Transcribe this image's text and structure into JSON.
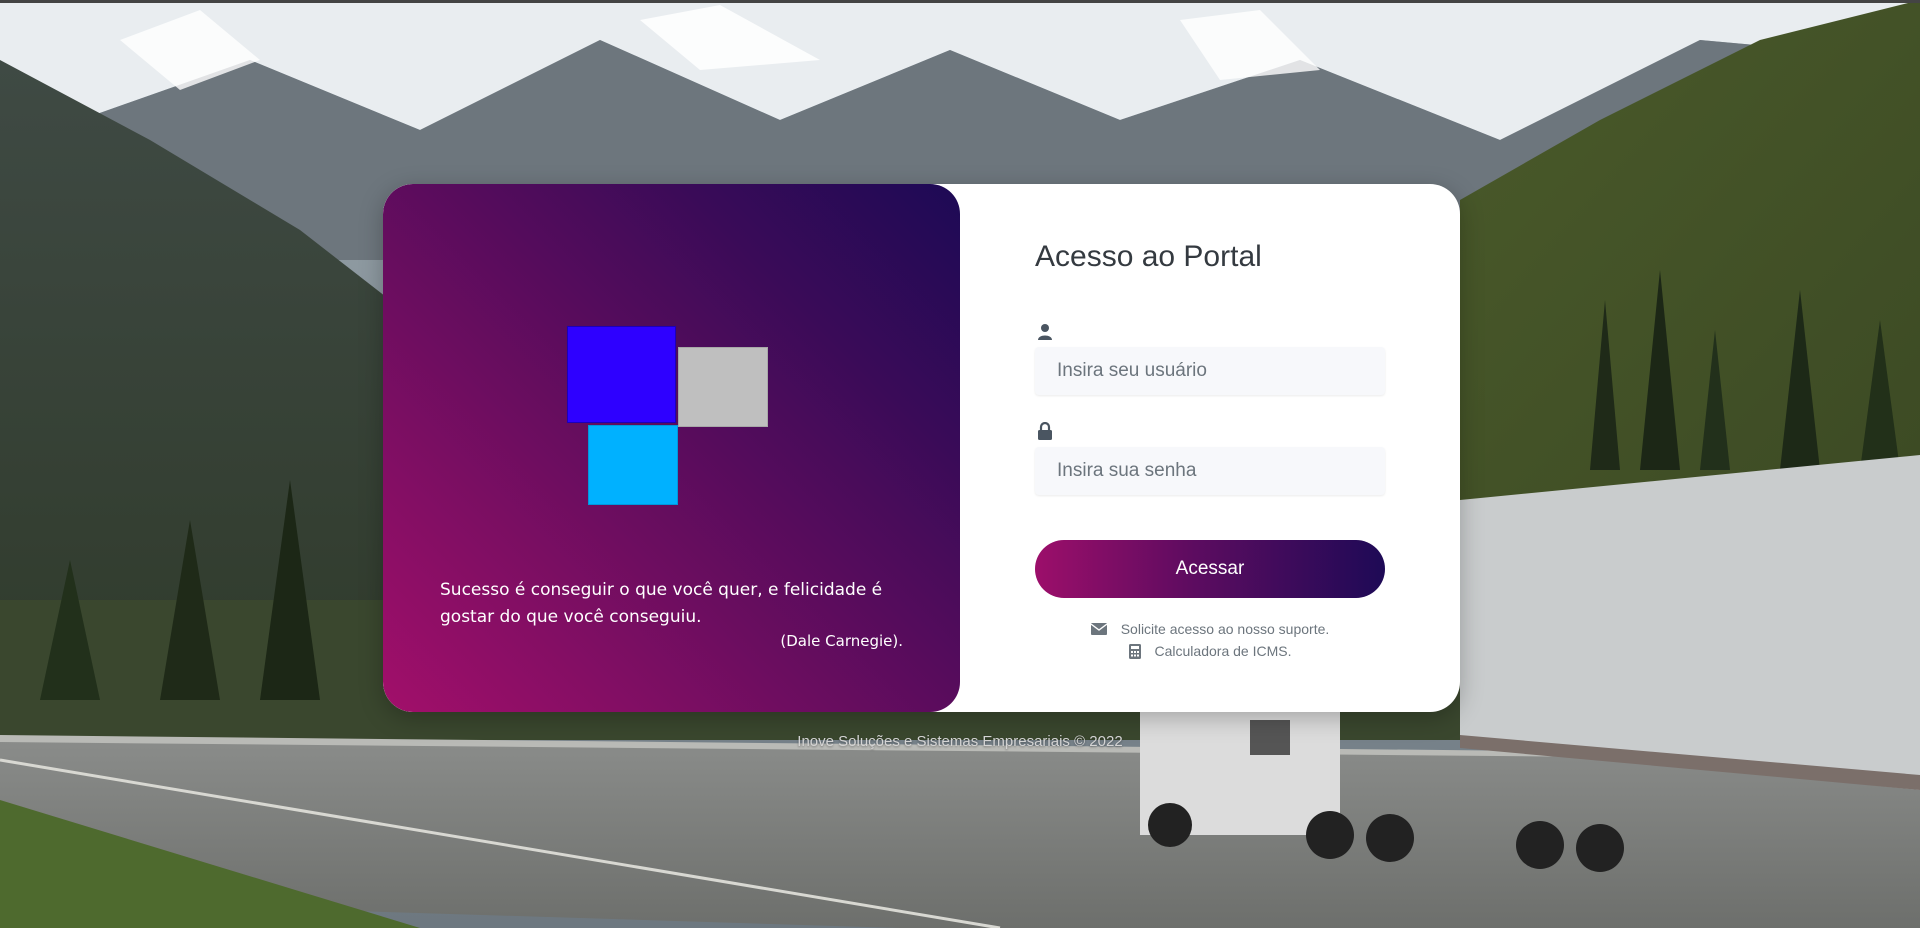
{
  "login_panel": {
    "title": "Acesso ao Portal",
    "username_placeholder": "Insira seu usuário",
    "username_value": "",
    "password_placeholder": "Insira sua senha",
    "password_value": "",
    "submit_label": "Acessar",
    "support_link": "Solicite acesso ao nosso suporte.",
    "calculator_link": "Calculadora de ICMS."
  },
  "branding_panel": {
    "quote": "Sucesso é conseguir o que você quer, e felicidade é gostar do que você conseguiu.",
    "author": "(Dale Carnegie).",
    "colors": {
      "gradient_start": "#a20f6a",
      "gradient_end": "#1d0a55",
      "logo_square_blue": "#2e00ff",
      "logo_square_gray": "#bfbfbf",
      "logo_square_cyan": "#00b1ff"
    }
  },
  "icons": {
    "user": "user-icon",
    "lock": "lock-icon",
    "envelope": "envelope-icon",
    "calculator": "calculator-icon"
  },
  "footer": {
    "text": "Inove Soluções e Sistemas Empresariais © 2022"
  }
}
